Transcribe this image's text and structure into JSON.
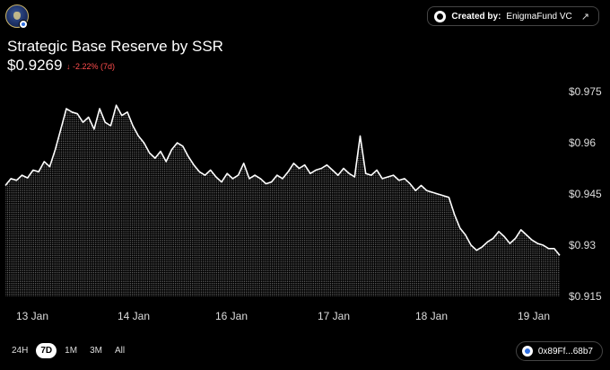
{
  "header": {
    "creator_prefix": "Created by:",
    "creator_name": "EnigmaFund VC",
    "title": "Strategic Base Reserve by SSR",
    "price": "$0.9269",
    "change": "-2.22% (7d)"
  },
  "controls": {
    "ranges": [
      "24H",
      "7D",
      "1M",
      "3M",
      "All"
    ],
    "active_range": "7D",
    "address": "0x89Ff...68b7"
  },
  "colors": {
    "line": "#ffffff",
    "fill": "#ffffff",
    "negative": "#ff4d4d",
    "background": "#000000"
  },
  "chart_data": {
    "type": "area",
    "x_ticks": [
      "13 Jan",
      "14 Jan",
      "16 Jan",
      "17 Jan",
      "18 Jan",
      "19 Jan"
    ],
    "y_ticks": [
      "0.975",
      "0.96",
      "0.945",
      "0.93",
      "0.915"
    ],
    "y_tick_values": [
      0.975,
      0.96,
      0.945,
      0.93,
      0.915
    ],
    "ylim": [
      0.915,
      0.975
    ],
    "grid": false,
    "y_axis_position": "right",
    "series": [
      {
        "values": [
          0.9475,
          0.9495,
          0.949,
          0.9505,
          0.9497,
          0.952,
          0.9515,
          0.9545,
          0.953,
          0.958,
          0.964,
          0.97,
          0.969,
          0.9685,
          0.966,
          0.9675,
          0.964,
          0.97,
          0.966,
          0.965,
          0.971,
          0.968,
          0.969,
          0.965,
          0.962,
          0.96,
          0.957,
          0.9555,
          0.9575,
          0.9545,
          0.958,
          0.96,
          0.959,
          0.956,
          0.9535,
          0.9515,
          0.9505,
          0.952,
          0.95,
          0.9485,
          0.951,
          0.9495,
          0.9505,
          0.954,
          0.9495,
          0.9505,
          0.9495,
          0.948,
          0.9485,
          0.9505,
          0.9495,
          0.9515,
          0.954,
          0.9525,
          0.9535,
          0.951,
          0.952,
          0.9525,
          0.9535,
          0.952,
          0.9505,
          0.9525,
          0.951,
          0.95,
          0.962,
          0.951,
          0.9505,
          0.952,
          0.9495,
          0.95,
          0.9505,
          0.949,
          0.9495,
          0.948,
          0.946,
          0.9475,
          0.946,
          0.9455,
          0.945,
          0.9445,
          0.944,
          0.939,
          0.935,
          0.933,
          0.93,
          0.9285,
          0.9295,
          0.931,
          0.932,
          0.934,
          0.9325,
          0.9305,
          0.932,
          0.9345,
          0.933,
          0.9315,
          0.9305,
          0.93,
          0.929,
          0.929,
          0.927
        ]
      }
    ]
  }
}
